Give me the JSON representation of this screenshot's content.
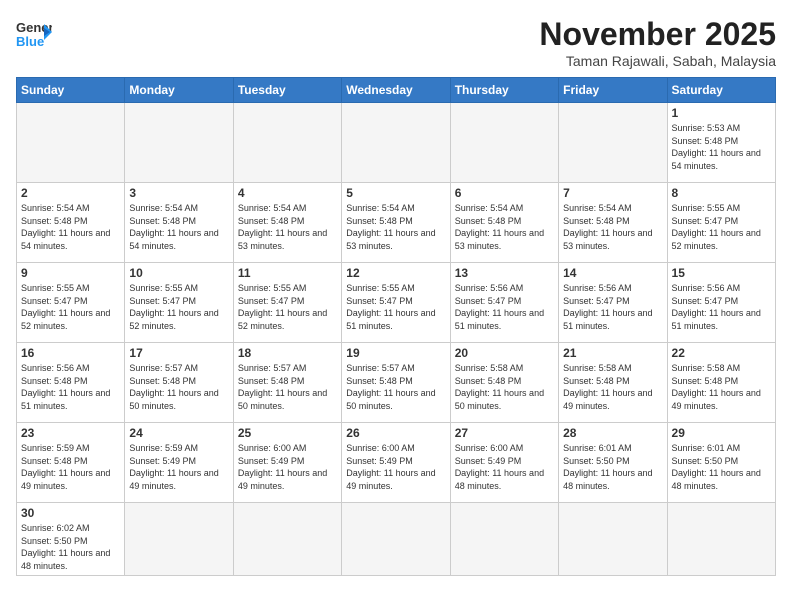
{
  "header": {
    "logo_general": "General",
    "logo_blue": "Blue",
    "month_title": "November 2025",
    "location": "Taman Rajawali, Sabah, Malaysia"
  },
  "weekdays": [
    "Sunday",
    "Monday",
    "Tuesday",
    "Wednesday",
    "Thursday",
    "Friday",
    "Saturday"
  ],
  "weeks": [
    [
      {
        "day": "",
        "info": ""
      },
      {
        "day": "",
        "info": ""
      },
      {
        "day": "",
        "info": ""
      },
      {
        "day": "",
        "info": ""
      },
      {
        "day": "",
        "info": ""
      },
      {
        "day": "",
        "info": ""
      },
      {
        "day": "1",
        "info": "Sunrise: 5:53 AM\nSunset: 5:48 PM\nDaylight: 11 hours and 54 minutes."
      }
    ],
    [
      {
        "day": "2",
        "info": "Sunrise: 5:54 AM\nSunset: 5:48 PM\nDaylight: 11 hours and 54 minutes."
      },
      {
        "day": "3",
        "info": "Sunrise: 5:54 AM\nSunset: 5:48 PM\nDaylight: 11 hours and 54 minutes."
      },
      {
        "day": "4",
        "info": "Sunrise: 5:54 AM\nSunset: 5:48 PM\nDaylight: 11 hours and 53 minutes."
      },
      {
        "day": "5",
        "info": "Sunrise: 5:54 AM\nSunset: 5:48 PM\nDaylight: 11 hours and 53 minutes."
      },
      {
        "day": "6",
        "info": "Sunrise: 5:54 AM\nSunset: 5:48 PM\nDaylight: 11 hours and 53 minutes."
      },
      {
        "day": "7",
        "info": "Sunrise: 5:54 AM\nSunset: 5:48 PM\nDaylight: 11 hours and 53 minutes."
      },
      {
        "day": "8",
        "info": "Sunrise: 5:55 AM\nSunset: 5:47 PM\nDaylight: 11 hours and 52 minutes."
      }
    ],
    [
      {
        "day": "9",
        "info": "Sunrise: 5:55 AM\nSunset: 5:47 PM\nDaylight: 11 hours and 52 minutes."
      },
      {
        "day": "10",
        "info": "Sunrise: 5:55 AM\nSunset: 5:47 PM\nDaylight: 11 hours and 52 minutes."
      },
      {
        "day": "11",
        "info": "Sunrise: 5:55 AM\nSunset: 5:47 PM\nDaylight: 11 hours and 52 minutes."
      },
      {
        "day": "12",
        "info": "Sunrise: 5:55 AM\nSunset: 5:47 PM\nDaylight: 11 hours and 51 minutes."
      },
      {
        "day": "13",
        "info": "Sunrise: 5:56 AM\nSunset: 5:47 PM\nDaylight: 11 hours and 51 minutes."
      },
      {
        "day": "14",
        "info": "Sunrise: 5:56 AM\nSunset: 5:47 PM\nDaylight: 11 hours and 51 minutes."
      },
      {
        "day": "15",
        "info": "Sunrise: 5:56 AM\nSunset: 5:47 PM\nDaylight: 11 hours and 51 minutes."
      }
    ],
    [
      {
        "day": "16",
        "info": "Sunrise: 5:56 AM\nSunset: 5:48 PM\nDaylight: 11 hours and 51 minutes."
      },
      {
        "day": "17",
        "info": "Sunrise: 5:57 AM\nSunset: 5:48 PM\nDaylight: 11 hours and 50 minutes."
      },
      {
        "day": "18",
        "info": "Sunrise: 5:57 AM\nSunset: 5:48 PM\nDaylight: 11 hours and 50 minutes."
      },
      {
        "day": "19",
        "info": "Sunrise: 5:57 AM\nSunset: 5:48 PM\nDaylight: 11 hours and 50 minutes."
      },
      {
        "day": "20",
        "info": "Sunrise: 5:58 AM\nSunset: 5:48 PM\nDaylight: 11 hours and 50 minutes."
      },
      {
        "day": "21",
        "info": "Sunrise: 5:58 AM\nSunset: 5:48 PM\nDaylight: 11 hours and 49 minutes."
      },
      {
        "day": "22",
        "info": "Sunrise: 5:58 AM\nSunset: 5:48 PM\nDaylight: 11 hours and 49 minutes."
      }
    ],
    [
      {
        "day": "23",
        "info": "Sunrise: 5:59 AM\nSunset: 5:48 PM\nDaylight: 11 hours and 49 minutes."
      },
      {
        "day": "24",
        "info": "Sunrise: 5:59 AM\nSunset: 5:49 PM\nDaylight: 11 hours and 49 minutes."
      },
      {
        "day": "25",
        "info": "Sunrise: 6:00 AM\nSunset: 5:49 PM\nDaylight: 11 hours and 49 minutes."
      },
      {
        "day": "26",
        "info": "Sunrise: 6:00 AM\nSunset: 5:49 PM\nDaylight: 11 hours and 49 minutes."
      },
      {
        "day": "27",
        "info": "Sunrise: 6:00 AM\nSunset: 5:49 PM\nDaylight: 11 hours and 48 minutes."
      },
      {
        "day": "28",
        "info": "Sunrise: 6:01 AM\nSunset: 5:50 PM\nDaylight: 11 hours and 48 minutes."
      },
      {
        "day": "29",
        "info": "Sunrise: 6:01 AM\nSunset: 5:50 PM\nDaylight: 11 hours and 48 minutes."
      }
    ],
    [
      {
        "day": "30",
        "info": "Sunrise: 6:02 AM\nSunset: 5:50 PM\nDaylight: 11 hours and 48 minutes."
      },
      {
        "day": "",
        "info": ""
      },
      {
        "day": "",
        "info": ""
      },
      {
        "day": "",
        "info": ""
      },
      {
        "day": "",
        "info": ""
      },
      {
        "day": "",
        "info": ""
      },
      {
        "day": "",
        "info": ""
      }
    ]
  ]
}
